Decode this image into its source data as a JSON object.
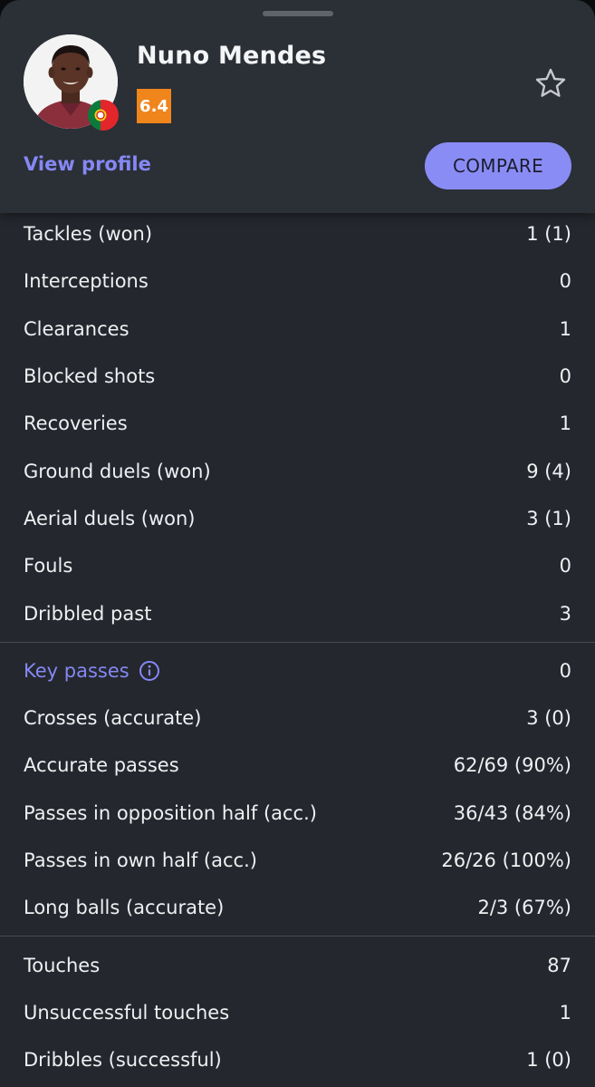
{
  "player": {
    "name": "Nuno Mendes",
    "rating": "6.4",
    "view_profile_label": "View profile",
    "compare_label": "COMPARE"
  },
  "colors": {
    "accent": "#8588f3",
    "rating_bg": "#f0851c",
    "sheet_bg": "#24272d",
    "header_bg": "#2b2f36"
  },
  "icons": {
    "favorite": "star-outline-icon",
    "info": "info-circle-icon",
    "flag": "portugal-flag-icon"
  },
  "sections": [
    {
      "rows": [
        {
          "label": "Tackles (won)",
          "value": "1 (1)"
        },
        {
          "label": "Interceptions",
          "value": "0"
        },
        {
          "label": "Clearances",
          "value": "1"
        },
        {
          "label": "Blocked shots",
          "value": "0"
        },
        {
          "label": "Recoveries",
          "value": "1"
        },
        {
          "label": "Ground duels (won)",
          "value": "9 (4)"
        },
        {
          "label": "Aerial duels (won)",
          "value": "3 (1)"
        },
        {
          "label": "Fouls",
          "value": "0"
        },
        {
          "label": "Dribbled past",
          "value": "3"
        }
      ]
    },
    {
      "rows": [
        {
          "label": "Key passes",
          "value": "0"
        },
        {
          "label": "Crosses (accurate)",
          "value": "3 (0)"
        },
        {
          "label": "Accurate passes",
          "value": "62/69 (90%)"
        },
        {
          "label": "Passes in opposition half (acc.)",
          "value": "36/43 (84%)"
        },
        {
          "label": "Passes in own half (acc.)",
          "value": "26/26 (100%)"
        },
        {
          "label": "Long balls (accurate)",
          "value": "2/3 (67%)"
        }
      ]
    },
    {
      "rows": [
        {
          "label": "Touches",
          "value": "87"
        },
        {
          "label": "Unsuccessful touches",
          "value": "1"
        },
        {
          "label": "Dribbles (successful)",
          "value": "1 (0)"
        }
      ]
    }
  ]
}
